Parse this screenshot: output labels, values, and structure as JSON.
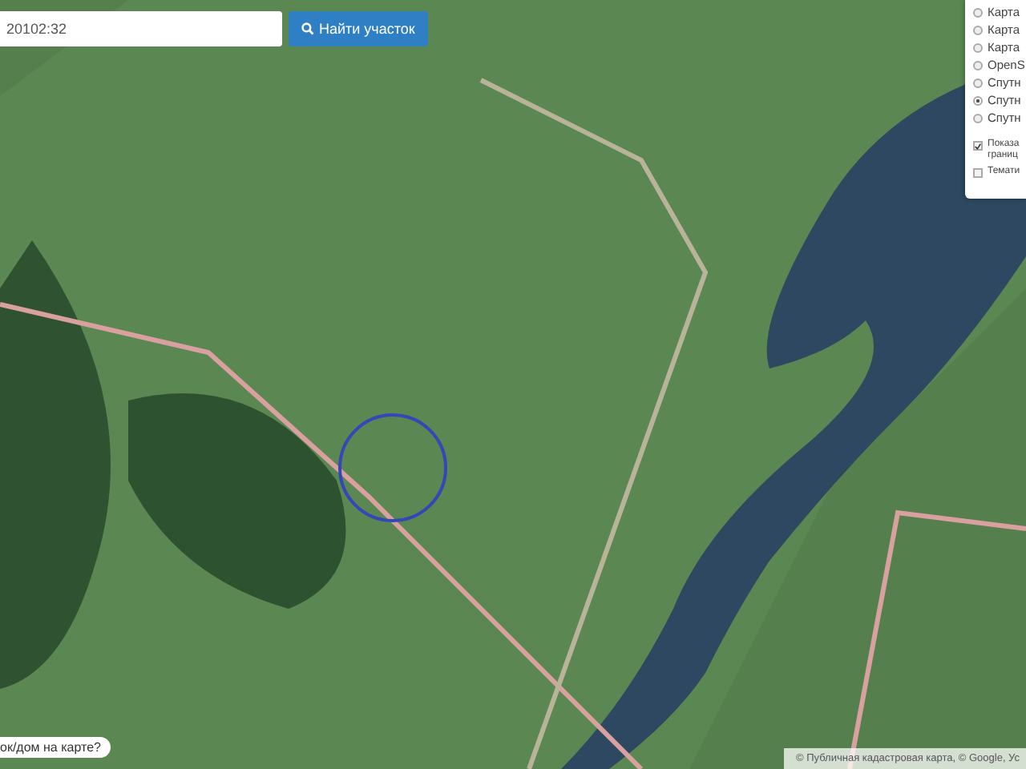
{
  "search": {
    "value": "20102:32",
    "button": "Найти участок"
  },
  "layers": [
    {
      "label": "Карта",
      "selected": false
    },
    {
      "label": "Карта",
      "selected": false
    },
    {
      "label": "Карта",
      "selected": false
    },
    {
      "label": "OpenS",
      "selected": false
    },
    {
      "label": "Спутн",
      "selected": false
    },
    {
      "label": "Спутн",
      "selected": true
    },
    {
      "label": "Спутн",
      "selected": false
    }
  ],
  "overlays": [
    {
      "label": "Показа\nграниц",
      "checked": true
    },
    {
      "label": "Темати",
      "checked": false
    }
  ],
  "hint": "ок/дом на карте?",
  "attribution": "© Публичная кадастровая карта, © Google, Ус"
}
